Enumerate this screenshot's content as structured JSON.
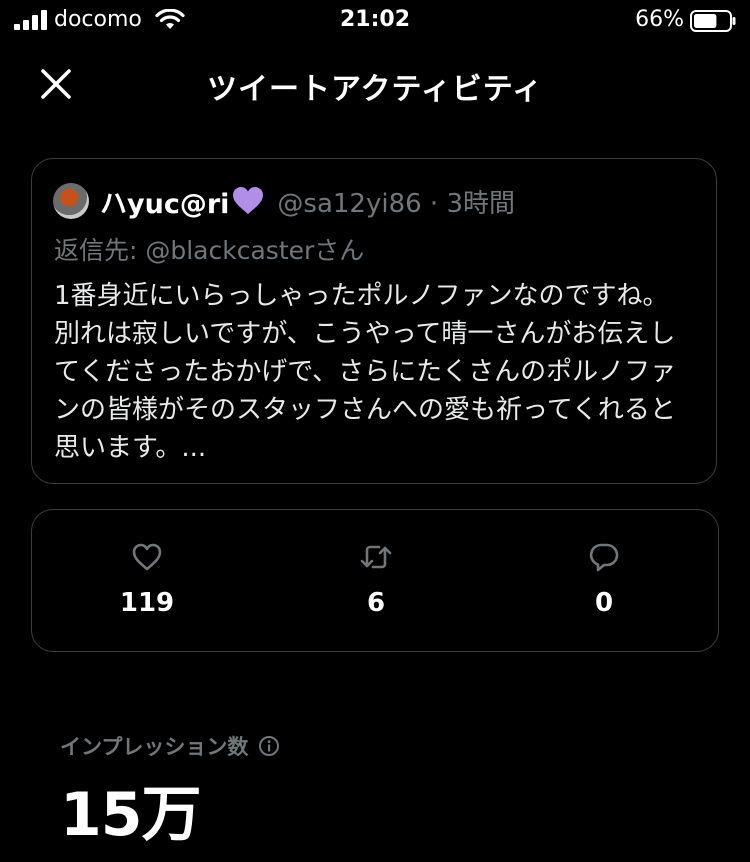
{
  "status_bar": {
    "carrier": "docomo",
    "time": "21:02",
    "battery_percent": "66%",
    "battery_level": 0.66
  },
  "header": {
    "title": "ツイートアクティビティ",
    "close_icon": "close-icon"
  },
  "tweet": {
    "display_name": "ハyuc@ri",
    "name_emoji": "purple-heart",
    "handle_time": "@sa12yi86 · 3時間",
    "reply_to": "返信先: @blackcasterさん",
    "text_lines": [
      "1番身近にいらっしゃったポルノファンなのですね。",
      "別れは寂しいですが、こうやって晴一さんがお伝えし",
      "てくださったおかげで、さらにたくさんのポルノファ",
      "ンの皆様がそのスタッフさんへの愛も祈ってくれると",
      "思います。..."
    ]
  },
  "engagement": {
    "likes": {
      "icon": "heart-icon",
      "count": "119"
    },
    "retweets": {
      "icon": "retweet-icon",
      "count": "6"
    },
    "replies": {
      "icon": "reply-icon",
      "count": "0"
    }
  },
  "impressions": {
    "label": "インプレッション数",
    "icon": "info-icon",
    "value": "15万"
  },
  "colors": {
    "background": "#000000",
    "text_primary": "#e7e9ea",
    "text_secondary": "#71767b",
    "border": "#3a3d41",
    "emoji_purple": "#b18ee8"
  }
}
